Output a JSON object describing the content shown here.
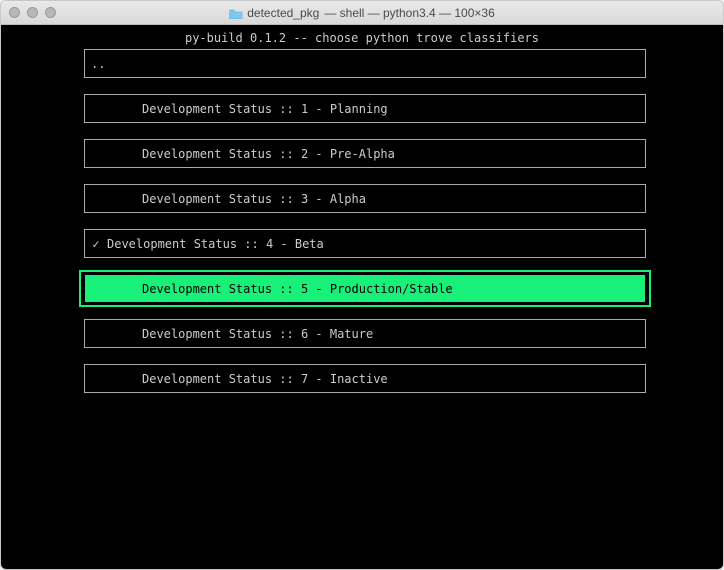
{
  "window": {
    "title_folder": "detected_pkg",
    "title_rest": " — shell — python3.4 — 100×36"
  },
  "app": {
    "header": "py-build 0.1.2 -- choose python trove classifiers"
  },
  "items": [
    {
      "label": "..",
      "checked": false,
      "highlighted": false,
      "parent": true
    },
    {
      "label": "Development Status :: 1 - Planning",
      "checked": false,
      "highlighted": false,
      "parent": false
    },
    {
      "label": "Development Status :: 2 - Pre-Alpha",
      "checked": false,
      "highlighted": false,
      "parent": false
    },
    {
      "label": "Development Status :: 3 - Alpha",
      "checked": false,
      "highlighted": false,
      "parent": false
    },
    {
      "label": "Development Status :: 4 - Beta",
      "checked": true,
      "highlighted": false,
      "parent": false
    },
    {
      "label": "Development Status :: 5 - Production/Stable",
      "checked": false,
      "highlighted": true,
      "parent": false
    },
    {
      "label": "Development Status :: 6 - Mature",
      "checked": false,
      "highlighted": false,
      "parent": false
    },
    {
      "label": "Development Status :: 7 - Inactive",
      "checked": false,
      "highlighted": false,
      "parent": false
    }
  ],
  "glyphs": {
    "check": "✓"
  },
  "colors": {
    "highlight": "#18f07a"
  }
}
